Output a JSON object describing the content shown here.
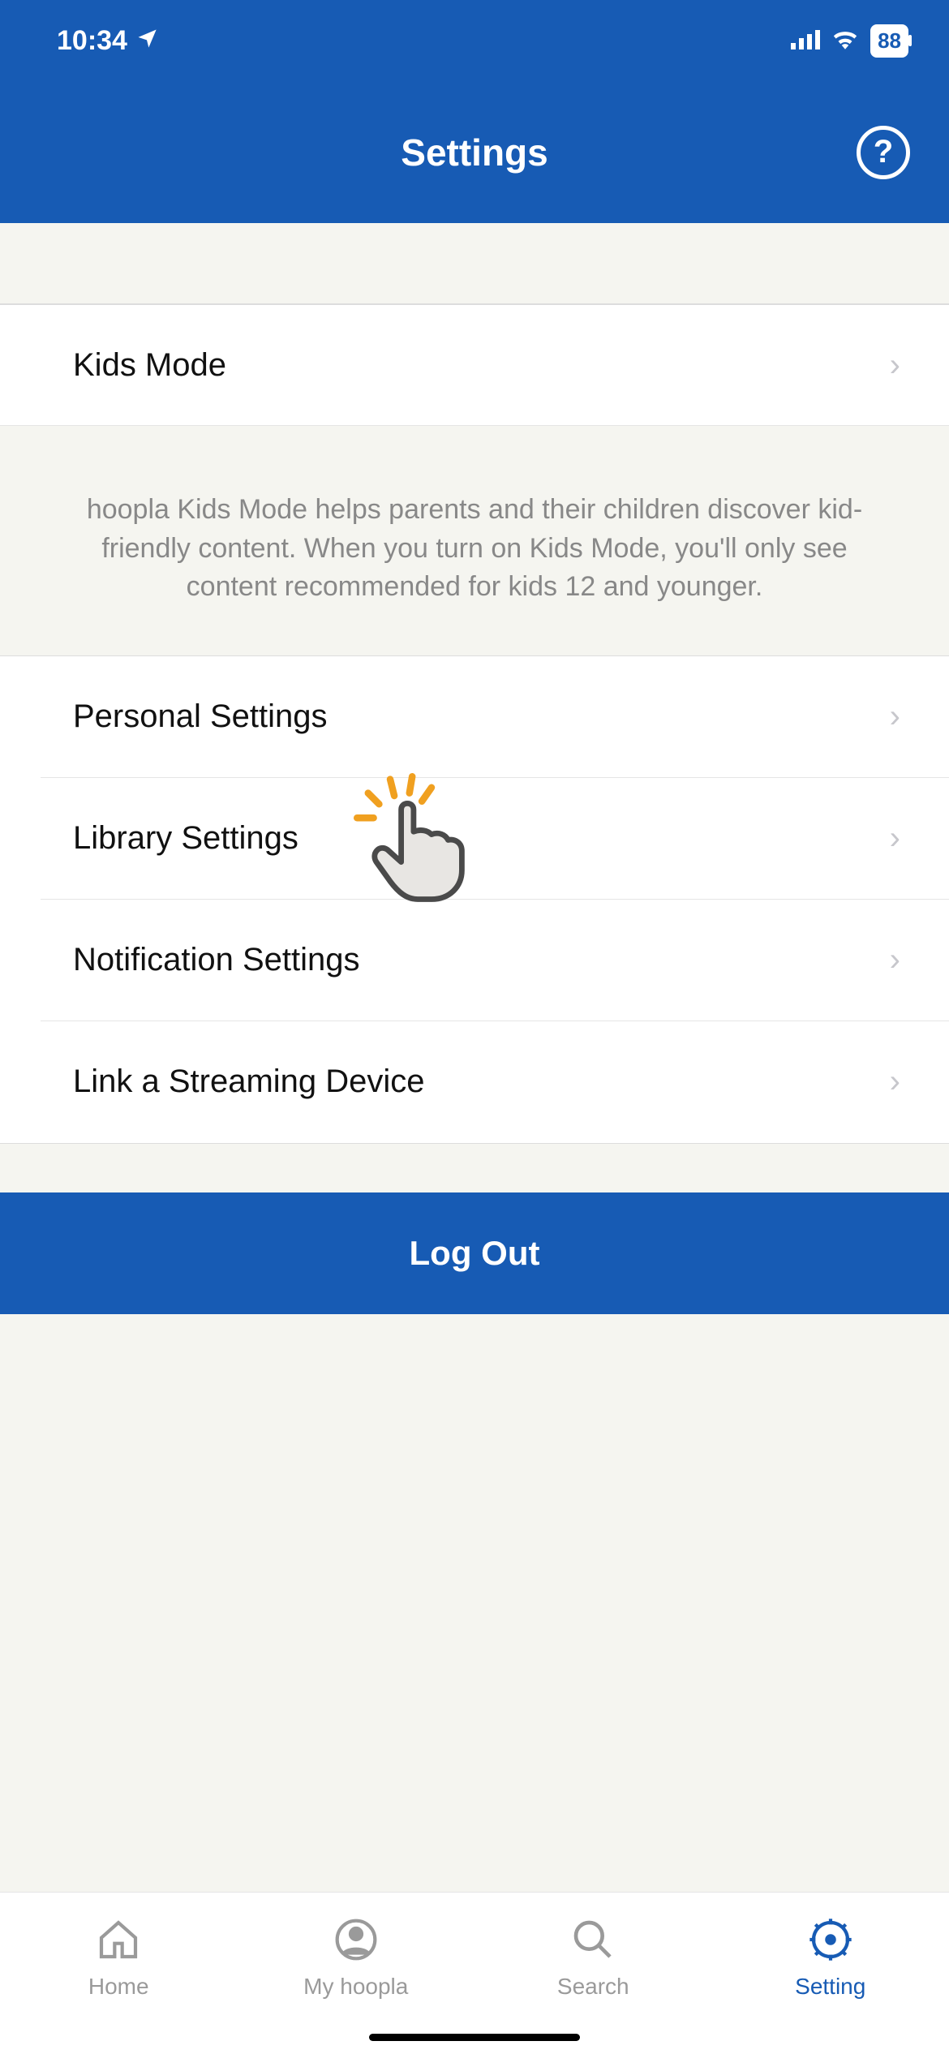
{
  "status": {
    "time": "10:34",
    "battery": "88"
  },
  "header": {
    "title": "Settings"
  },
  "rows": {
    "kids_mode": "Kids Mode",
    "desc": "hoopla Kids Mode helps parents and their children discover kid-friendly content. When you turn on Kids Mode, you'll only see content recommended for kids 12 and younger.",
    "personal": "Personal Settings",
    "library": "Library Settings",
    "notification": "Notification Settings",
    "link_device": "Link a Streaming Device"
  },
  "logout": "Log Out",
  "tabs": {
    "home": "Home",
    "myhoopla": "My hoopla",
    "search": "Search",
    "setting": "Setting"
  }
}
